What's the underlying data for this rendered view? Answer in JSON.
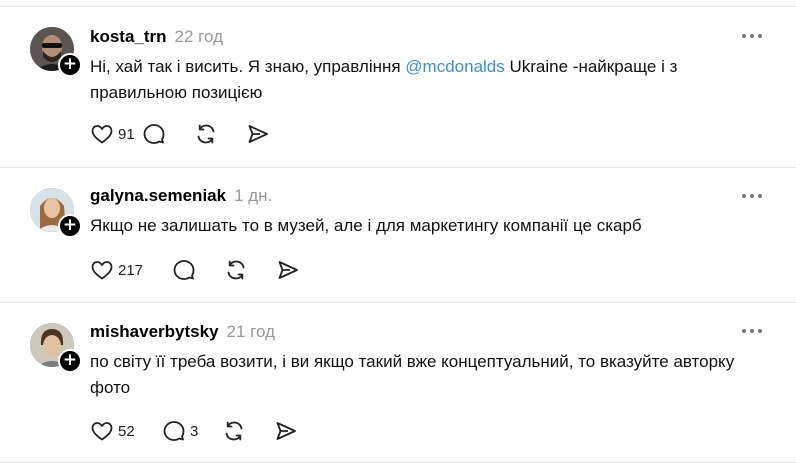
{
  "posts": [
    {
      "username": "kosta_trn",
      "time": "22 год",
      "text_before": "Ні, хай так і висить. Я знаю, управління ",
      "mention": "@mcdonalds",
      "text_after": " Ukraine -найкраще і з правильною позицією",
      "likes": "91",
      "comments": "",
      "avatar_color": "#4a4a4a"
    },
    {
      "username": "galyna.semeniak",
      "time": "1 дн.",
      "text_before": "Якщо не залишать то в музей, але і для маркетингу компанії це скарб",
      "mention": "",
      "text_after": "",
      "likes": "217",
      "comments": "",
      "avatar_color": "#c9b9a3"
    },
    {
      "username": "mishaverbytsky",
      "time": "21 год",
      "text_before": "по світу її треба возити, і ви якщо такий вже концептуальний, то вказуйте авторку фото",
      "mention": "",
      "text_after": "",
      "likes": "52",
      "comments": "3",
      "avatar_color": "#b8a894"
    }
  ],
  "icons": {
    "like": "heart-icon",
    "comment": "comment-bubble-icon",
    "repost": "repost-icon",
    "share": "send-icon",
    "more": "more-dots-icon",
    "follow": "plus-icon"
  },
  "colors": {
    "mention": "#3b8fd6",
    "timestamp": "#999999",
    "divider": "#e3e3e3"
  }
}
